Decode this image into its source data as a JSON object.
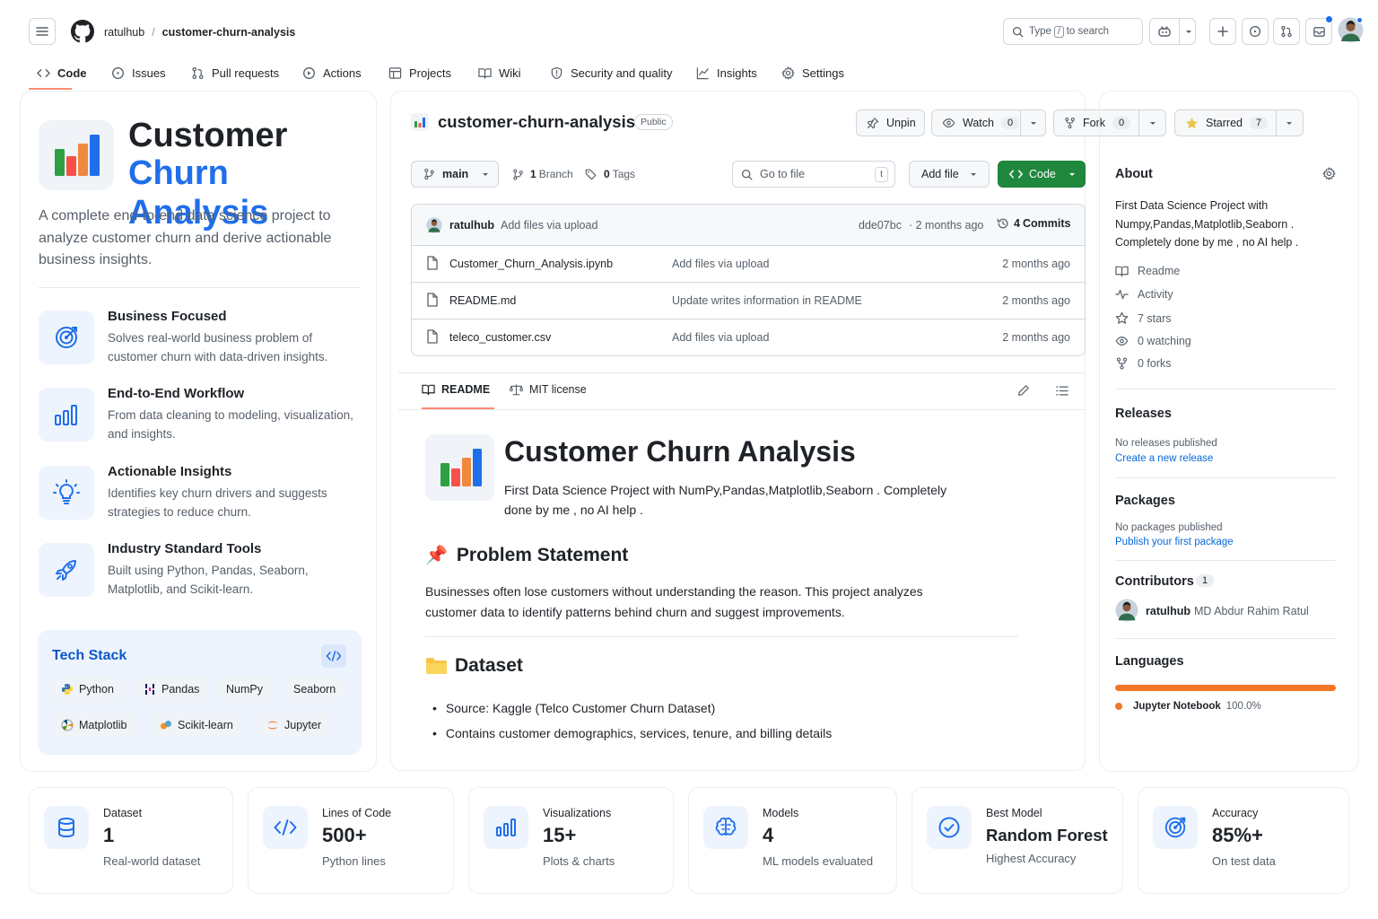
{
  "header": {
    "owner": "ratulhub",
    "separator": "/",
    "repo": "customer-churn-analysis",
    "search_placeholder": "Type / to search",
    "search_text": "Type",
    "search_key": "/",
    "search_suffix": "to search"
  },
  "nav": {
    "tabs": [
      {
        "label": "Code",
        "icon": "code-icon",
        "active": true
      },
      {
        "label": "Issues",
        "icon": "issue-icon"
      },
      {
        "label": "Pull requests",
        "icon": "pull-request-icon"
      },
      {
        "label": "Actions",
        "icon": "actions-icon"
      },
      {
        "label": "Projects",
        "icon": "table-icon"
      },
      {
        "label": "Wiki",
        "icon": "book-icon"
      },
      {
        "label": "Security and quality",
        "icon": "shield-icon"
      },
      {
        "label": "Insights",
        "icon": "graph-icon"
      },
      {
        "label": "Settings",
        "icon": "gear-icon"
      }
    ]
  },
  "left": {
    "title_line1": "Customer",
    "title_line2": "Churn Analysis",
    "description": "A complete end-to-end data science project to analyze customer churn and derive actionable business insights.",
    "features": [
      {
        "title": "Business Focused",
        "desc": "Solves real-world business problem of customer churn with data-driven insights.",
        "icon": "target-icon"
      },
      {
        "title": "End-to-End Workflow",
        "desc": "From data cleaning to modeling, visualization, and insights.",
        "icon": "bar-chart-icon"
      },
      {
        "title": "Actionable Insights",
        "desc": "Identifies key churn drivers and suggests strategies to reduce churn.",
        "icon": "lightbulb-icon"
      },
      {
        "title": "Industry Standard Tools",
        "desc": "Built using Python, Pandas, Seaborn, Matplotlib, and Scikit-learn.",
        "icon": "rocket-icon"
      }
    ],
    "tech_stack_title": "Tech Stack",
    "tech": [
      "Python",
      "Pandas",
      "NumPy",
      "Seaborn",
      "Matplotlib",
      "Scikit-learn",
      "Jupyter"
    ]
  },
  "repo": {
    "name": "customer-churn-analysis",
    "visibility": "Public",
    "unpin": "Unpin",
    "watch": "Watch",
    "watch_count": "0",
    "fork": "Fork",
    "fork_count": "0",
    "starred": "Starred",
    "star_count": "7",
    "branch": "main",
    "branch_count": "1",
    "branch_label": "Branch",
    "tag_count": "0",
    "tag_label": "Tags",
    "goto_placeholder": "Go to file",
    "goto_key": "t",
    "add_file": "Add file",
    "code_btn": "Code",
    "commit_author": "ratulhub",
    "commit_message": "Add files via upload",
    "commit_hash": "dde07bc",
    "commit_time": "· 2 months ago",
    "commits_count": "4",
    "commits_label": "Commits",
    "files": [
      {
        "name": "Customer_Churn_Analysis.ipynb",
        "msg": "Add files via upload",
        "time": "2 months ago"
      },
      {
        "name": "README.md",
        "msg": "Update writes information in README",
        "time": "2 months ago"
      },
      {
        "name": "teleco_customer.csv",
        "msg": "Add files via upload",
        "time": "2 months ago"
      }
    ]
  },
  "readme": {
    "tab_readme": "README",
    "tab_license": "MIT license",
    "title": "Customer Churn Analysis",
    "intro": "First Data Science Project with NumPy,Pandas,Matplotlib,Seaborn . Completely done by me , no AI help .",
    "problem_emoji": "📌",
    "problem_title": "Problem Statement",
    "problem_text": "Businesses often lose customers without understanding the reason. This project analyzes customer data to identify patterns behind churn and suggest improvements.",
    "dataset_title": "Dataset",
    "dataset_source_label": "Source:",
    "dataset_source": "Kaggle (Telco Customer Churn Dataset)",
    "dataset_item2": "Contains customer demographics, services, tenure, and billing details"
  },
  "about": {
    "title": "About",
    "description": "First Data Science Project with Numpy,Pandas,Matplotlib,Seaborn . Completely done by me , no AI help .",
    "links": [
      {
        "label": "Readme",
        "icon": "book-icon"
      },
      {
        "label": "Activity",
        "icon": "pulse-icon"
      },
      {
        "label": "7 stars",
        "icon": "star-icon"
      },
      {
        "label": "0 watching",
        "icon": "eye-icon"
      },
      {
        "label": "0 forks",
        "icon": "fork-icon"
      }
    ],
    "releases_title": "Releases",
    "releases_none": "No releases published",
    "releases_link": "Create a new release",
    "packages_title": "Packages",
    "packages_none": "No packages published",
    "packages_link": "Publish your first package",
    "contributors_title": "Contributors",
    "contributors_count": "1",
    "contributor_login": "ratulhub",
    "contributor_name": "MD Abdur Rahim Ratul",
    "languages_title": "Languages",
    "language": "Jupyter Notebook",
    "language_pct": "100.0%",
    "language_color": "#f37626"
  },
  "stats": [
    {
      "label": "Dataset",
      "value": "1",
      "sub": "Real-world dataset",
      "icon": "database-icon"
    },
    {
      "label": "Lines of Code",
      "value": "500+",
      "sub": "Python lines",
      "icon": "code-icon"
    },
    {
      "label": "Visualizations",
      "value": "15+",
      "sub": "Plots & charts",
      "icon": "bar-chart-icon"
    },
    {
      "label": "Models",
      "value": "4",
      "sub": "ML models evaluated",
      "icon": "brain-icon"
    },
    {
      "label": "Best Model",
      "value": "Random Forest",
      "sub": "Highest Accuracy",
      "icon": "check-circle-icon"
    },
    {
      "label": "Accuracy",
      "value": "85%+",
      "sub": "On test data",
      "icon": "target-icon"
    }
  ],
  "colors": {
    "accent": "#1f6feb",
    "green": "#1f883d",
    "orange": "#fd8c73"
  }
}
